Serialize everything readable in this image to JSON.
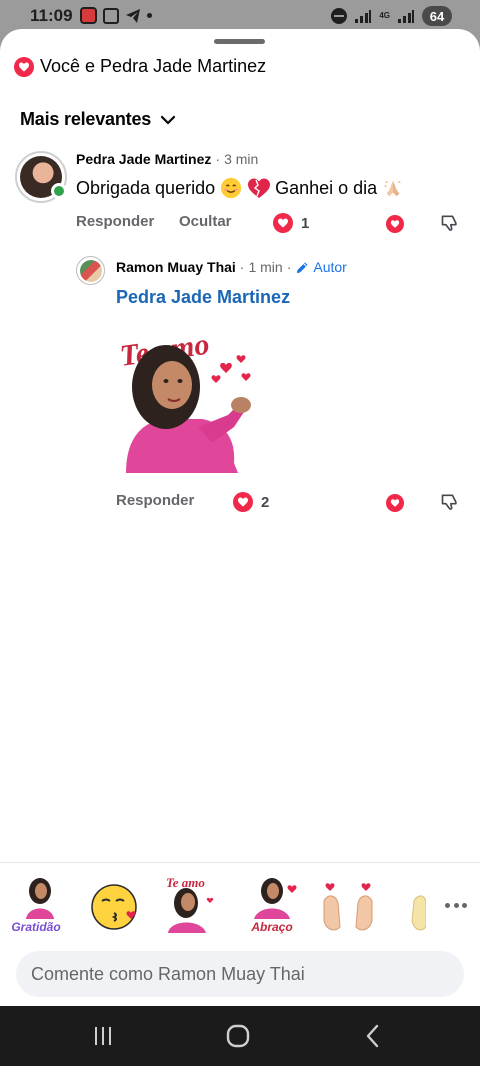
{
  "status_bar": {
    "time": "11:09",
    "network": "4G",
    "battery": "64",
    "icons": [
      "app-notification-icon",
      "screenshot-icon",
      "telegram-icon",
      "dot-icon",
      "do-not-disturb-icon",
      "wifi-signal-icon",
      "cell-signal-icon",
      "battery-icon"
    ]
  },
  "sheet": {
    "title": "Você e Pedra Jade Martinez",
    "sort_label": "Mais relevantes"
  },
  "comment": {
    "author": "Pedra Jade Martinez",
    "dot": "·",
    "time": "3 min",
    "text": "Obrigada querido",
    "text_end": "Ganhei o dia",
    "reply_label": "Responder",
    "hide_label": "Ocultar",
    "reaction_count": "1"
  },
  "reply": {
    "author": "Ramon Muay Thai",
    "dot": "·",
    "time": "1 min",
    "dot2": "·",
    "author_tag": "Autor",
    "mention": "Pedra Jade Martinez",
    "sticker_text": "Te amo",
    "reply_label": "Responder",
    "reaction_count": "2"
  },
  "sticker_tray": {
    "items": [
      {
        "name": "gratidao-sticker",
        "text": "Gratidão"
      },
      {
        "name": "kiss-emoji-sticker",
        "text": ""
      },
      {
        "name": "te-amo-sticker",
        "text": "Te amo"
      },
      {
        "name": "abraco-sticker",
        "text": "Abraço"
      },
      {
        "name": "finger-heart-sticker",
        "text": ""
      }
    ]
  },
  "composer": {
    "placeholder": "Comente como Ramon Muay Thai"
  },
  "colors": {
    "reaction_red": "#f0284a",
    "link_blue": "#1b66b5",
    "author_tag_blue": "#1b74e4",
    "online_green": "#31a24c",
    "secondary_text": "#65676b"
  }
}
